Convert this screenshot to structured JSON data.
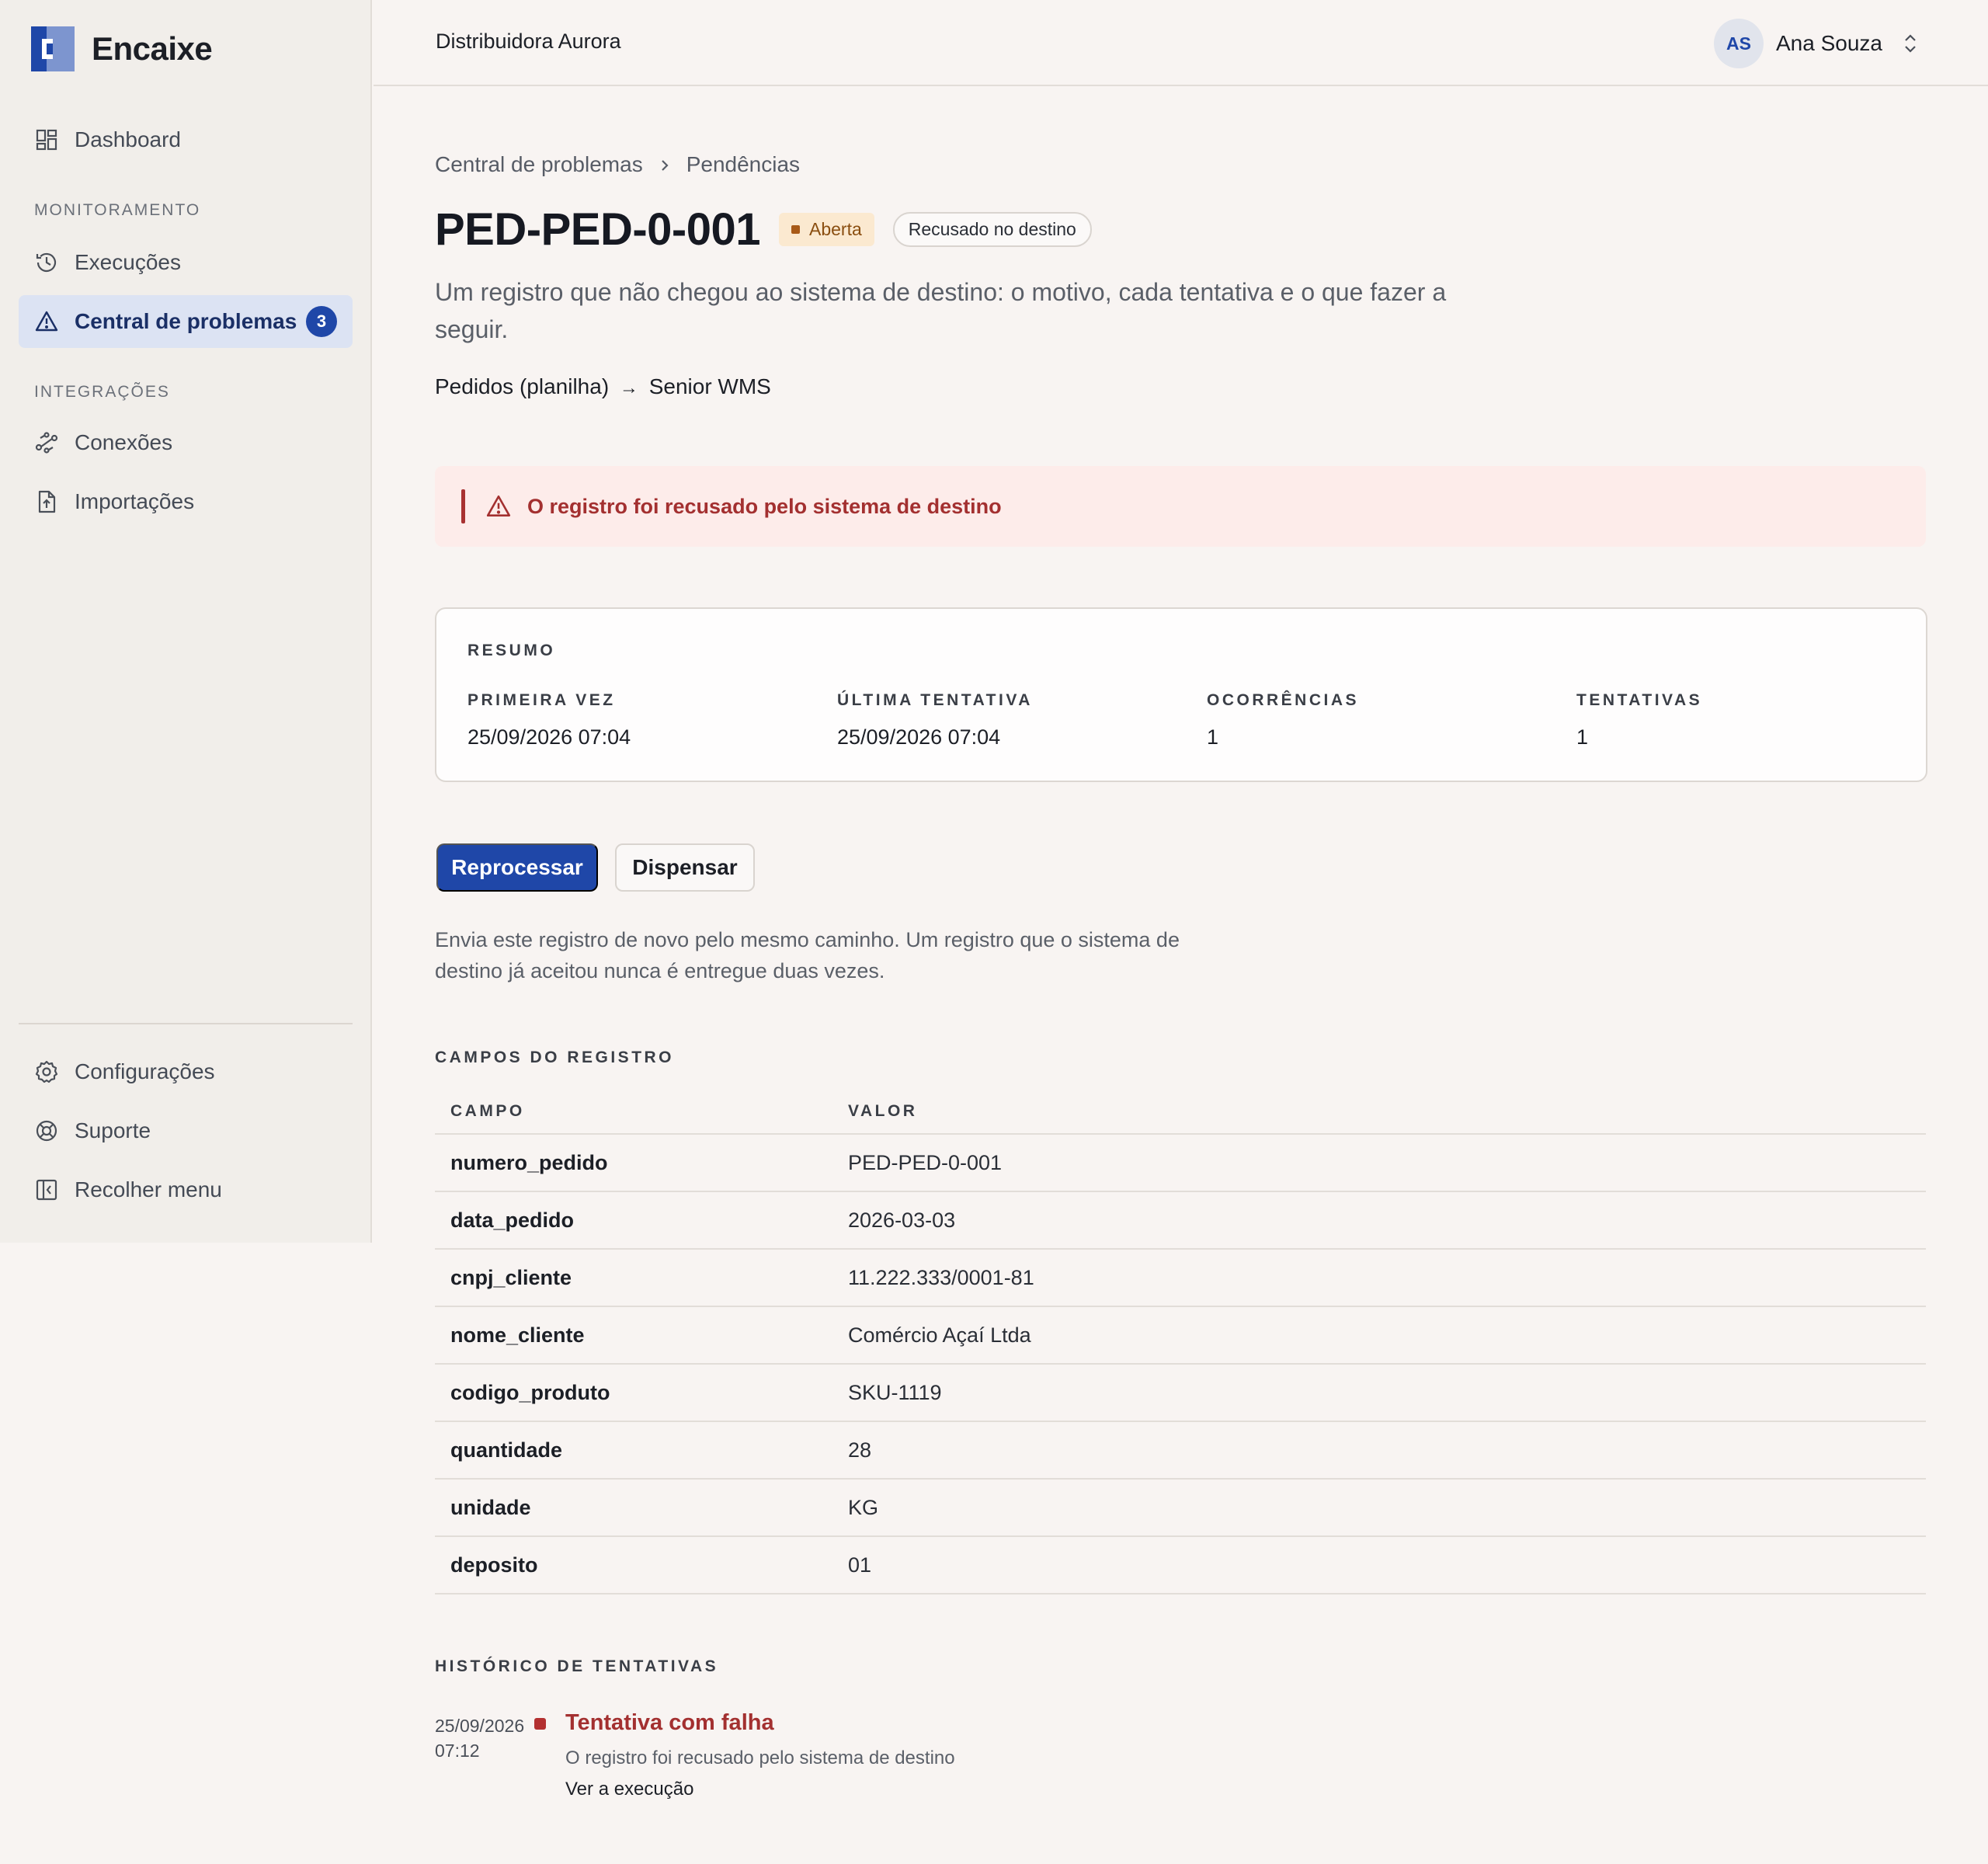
{
  "brand": {
    "name": "Encaixe",
    "accent": "#1f47a8"
  },
  "sidebar": {
    "dashboard": "Dashboard",
    "sections": {
      "monitoring": "MONITORAMENTO",
      "integrations": "INTEGRAÇÕES"
    },
    "monitoring_items": [
      {
        "label": "Execuções",
        "icon": "history-icon"
      },
      {
        "label": "Central de problemas",
        "icon": "warning-icon",
        "badge": "3",
        "active": true
      }
    ],
    "integration_items": [
      {
        "label": "Conexões",
        "icon": "connections-icon"
      },
      {
        "label": "Importações",
        "icon": "file-import-icon"
      }
    ],
    "footer_items": [
      {
        "label": "Configurações",
        "icon": "gear-icon"
      },
      {
        "label": "Suporte",
        "icon": "lifebuoy-icon"
      },
      {
        "label": "Recolher menu",
        "icon": "collapse-icon"
      }
    ]
  },
  "topbar": {
    "org": "Distribuidora Aurora",
    "user_initials": "AS",
    "user_name": "Ana Souza"
  },
  "breadcrumb": [
    "Central de problemas",
    "Pendências"
  ],
  "record": {
    "title": "PED-PED-0-001",
    "status": "Aberta",
    "reason": "Recusado no destino",
    "subtitle": "Um registro que não chegou ao sistema de destino: o motivo, cada tentativa e o que fazer a seguir.",
    "route_from": "Pedidos (planilha)",
    "route_arrow": "→",
    "route_to": "Senior WMS"
  },
  "alert": {
    "message": "O registro foi recusado pelo sistema de destino"
  },
  "summary": {
    "title": "RESUMO",
    "first_label": "PRIMEIRA VEZ",
    "first_value": "25/09/2026 07:04",
    "last_label": "ÚLTIMA TENTATIVA",
    "last_value": "25/09/2026 07:04",
    "occ_label": "OCORRÊNCIAS",
    "occ_value": "1",
    "tries_label": "TENTATIVAS",
    "tries_value": "1"
  },
  "actions": {
    "reprocess": "Reprocessar",
    "dismiss": "Dispensar",
    "help": "Envia este registro de novo pelo mesmo caminho. Um registro que o sistema de destino já aceitou nunca é entregue duas vezes."
  },
  "fields": {
    "title": "CAMPOS DO REGISTRO",
    "col_field": "CAMPO",
    "col_value": "VALOR",
    "rows": [
      {
        "key": "numero_pedido",
        "value": "PED-PED-0-001"
      },
      {
        "key": "data_pedido",
        "value": "2026-03-03"
      },
      {
        "key": "cnpj_cliente",
        "value": "11.222.333/0001-81"
      },
      {
        "key": "nome_cliente",
        "value": "Comércio Açaí Ltda"
      },
      {
        "key": "codigo_produto",
        "value": "SKU-1119"
      },
      {
        "key": "quantidade",
        "value": "28"
      },
      {
        "key": "unidade",
        "value": "KG"
      },
      {
        "key": "deposito",
        "value": "01"
      }
    ]
  },
  "history": {
    "title": "HISTÓRICO DE TENTATIVAS",
    "items": [
      {
        "date": "25/09/2026",
        "time": "07:12",
        "status": "Tentativa com falha",
        "message": "O registro foi recusado pelo sistema de destino",
        "link": "Ver a execução"
      }
    ]
  }
}
